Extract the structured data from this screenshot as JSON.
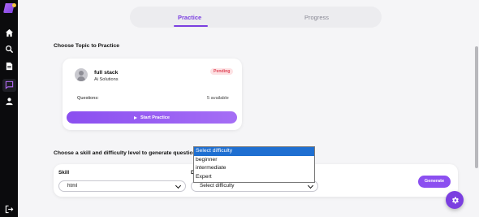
{
  "tabs": {
    "practice": "Practice",
    "progress": "Progress"
  },
  "sections": {
    "choose_topic": "Choose Topic to Practice",
    "choose_skill": "Choose a skill and difficulty level to generate questions"
  },
  "topic_card": {
    "title": "full stack",
    "subtitle": "Ai Solutions",
    "status_badge": "Pending",
    "questions_label": "Questions:",
    "questions_value": "5 available",
    "start_button": "Start Practice"
  },
  "generator": {
    "skill_label": "Skill",
    "skill_value": "html",
    "difficulty_label": "D",
    "difficulty_value": "Select difficulty",
    "generate_button": "Generate"
  },
  "difficulty_dropdown": {
    "options": [
      "Select difficulty",
      "beginner",
      "intermediate",
      "Expert"
    ],
    "highlighted": "Select difficulty"
  },
  "sidebar": {
    "icons": [
      "home-icon",
      "search-icon",
      "document-icon",
      "chat-icon",
      "user-icon",
      "logout-icon"
    ],
    "active": "chat-icon"
  },
  "colors": {
    "accent": "#7b3fe0",
    "sidebar_bg": "#0b0b0d",
    "badge_text": "#e0485a",
    "badge_bg": "#fde2e4",
    "dropdown_highlight": "#1f6fd1"
  }
}
